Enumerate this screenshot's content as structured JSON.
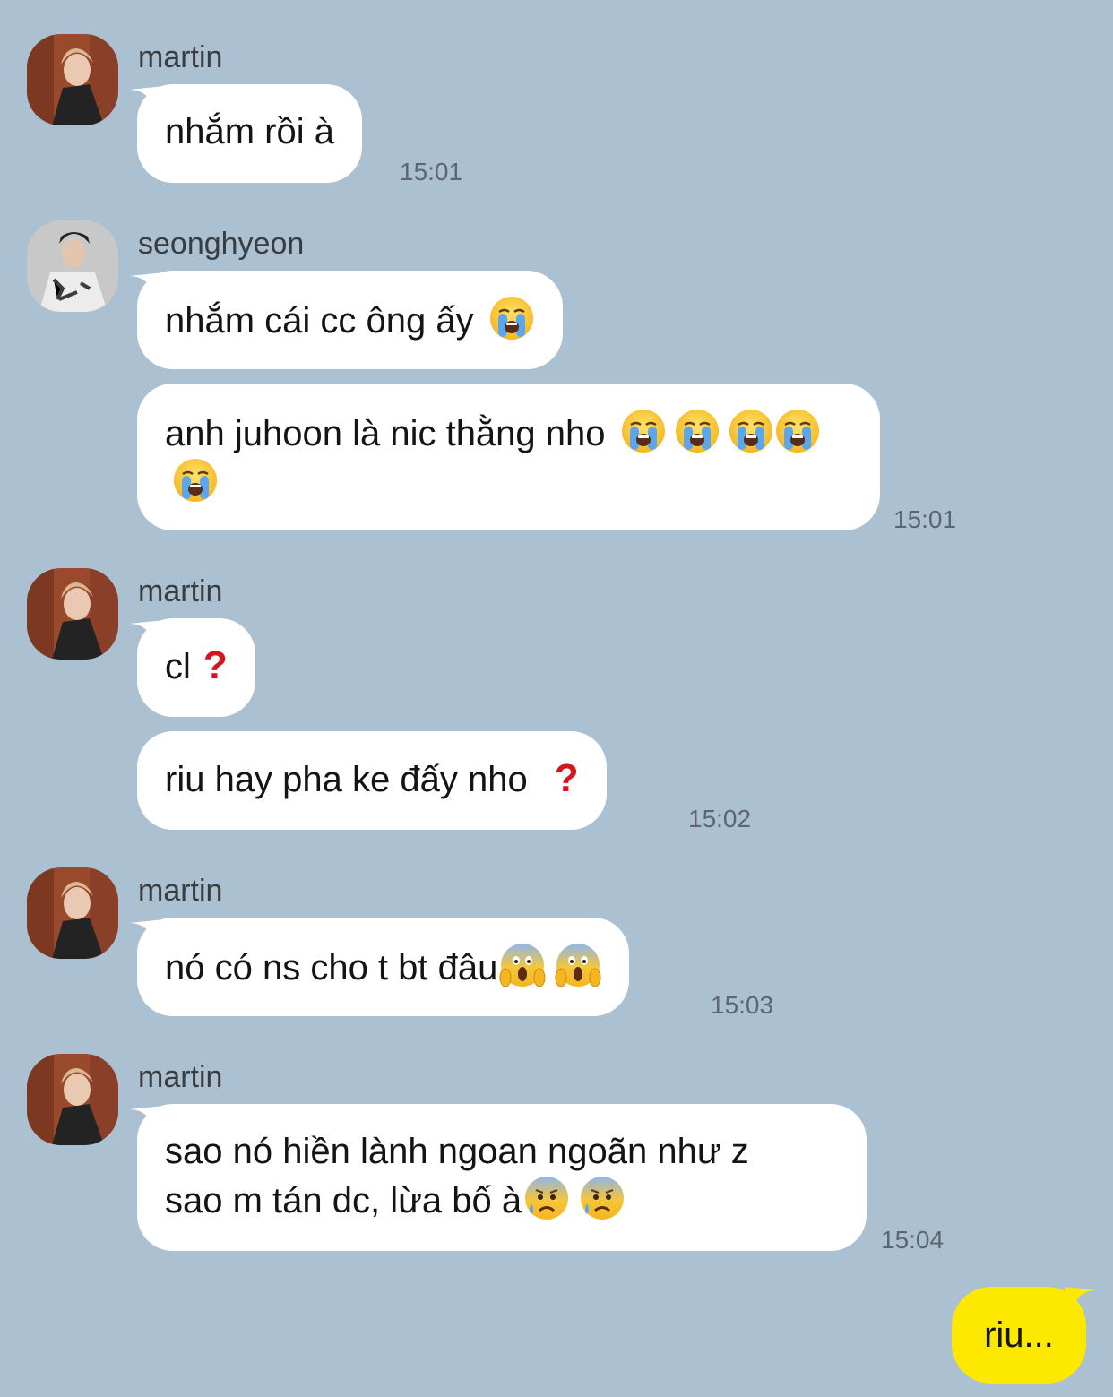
{
  "colors": {
    "background": "#abc1d1",
    "incoming_bubble": "#ffffff",
    "outgoing_bubble": "#fde900",
    "question_mark": "#d5151c"
  },
  "messages": [
    {
      "sender": "martin",
      "bubbles": [
        {
          "text": "nhắm rồi à",
          "emoji": []
        }
      ],
      "time": "15:01"
    },
    {
      "sender": "seonghyeon",
      "bubbles": [
        {
          "text": "nhắm cái cc ông ấy",
          "emoji": [
            "loudly-crying-face"
          ]
        },
        {
          "text": "anh juhoon là nic thằng nho",
          "emoji": [
            "loudly-crying-face",
            "loudly-crying-face",
            "loudly-crying-face",
            "loudly-crying-face",
            "loudly-crying-face"
          ]
        }
      ],
      "time": "15:01"
    },
    {
      "sender": "martin",
      "bubbles": [
        {
          "text": "cl",
          "emoji": [
            "red-question-mark"
          ]
        },
        {
          "text": "riu hay pha ke đấy nho",
          "emoji": [
            "red-question-mark"
          ]
        }
      ],
      "time": "15:02"
    },
    {
      "sender": "martin",
      "bubbles": [
        {
          "text": "nó có ns cho t bt đâu",
          "emoji": [
            "face-screaming-in-fear",
            "face-screaming-in-fear"
          ]
        }
      ],
      "time": "15:03"
    },
    {
      "sender": "martin",
      "bubbles": [
        {
          "text": "sao nó hiền lành ngoan ngoãn như z\nsao m tán dc, lừa bố à",
          "emoji": [
            "anxious-face-with-sweat",
            "anxious-face-with-sweat"
          ]
        }
      ],
      "time": "15:04"
    }
  ],
  "outgoing": {
    "text": "riu..."
  }
}
